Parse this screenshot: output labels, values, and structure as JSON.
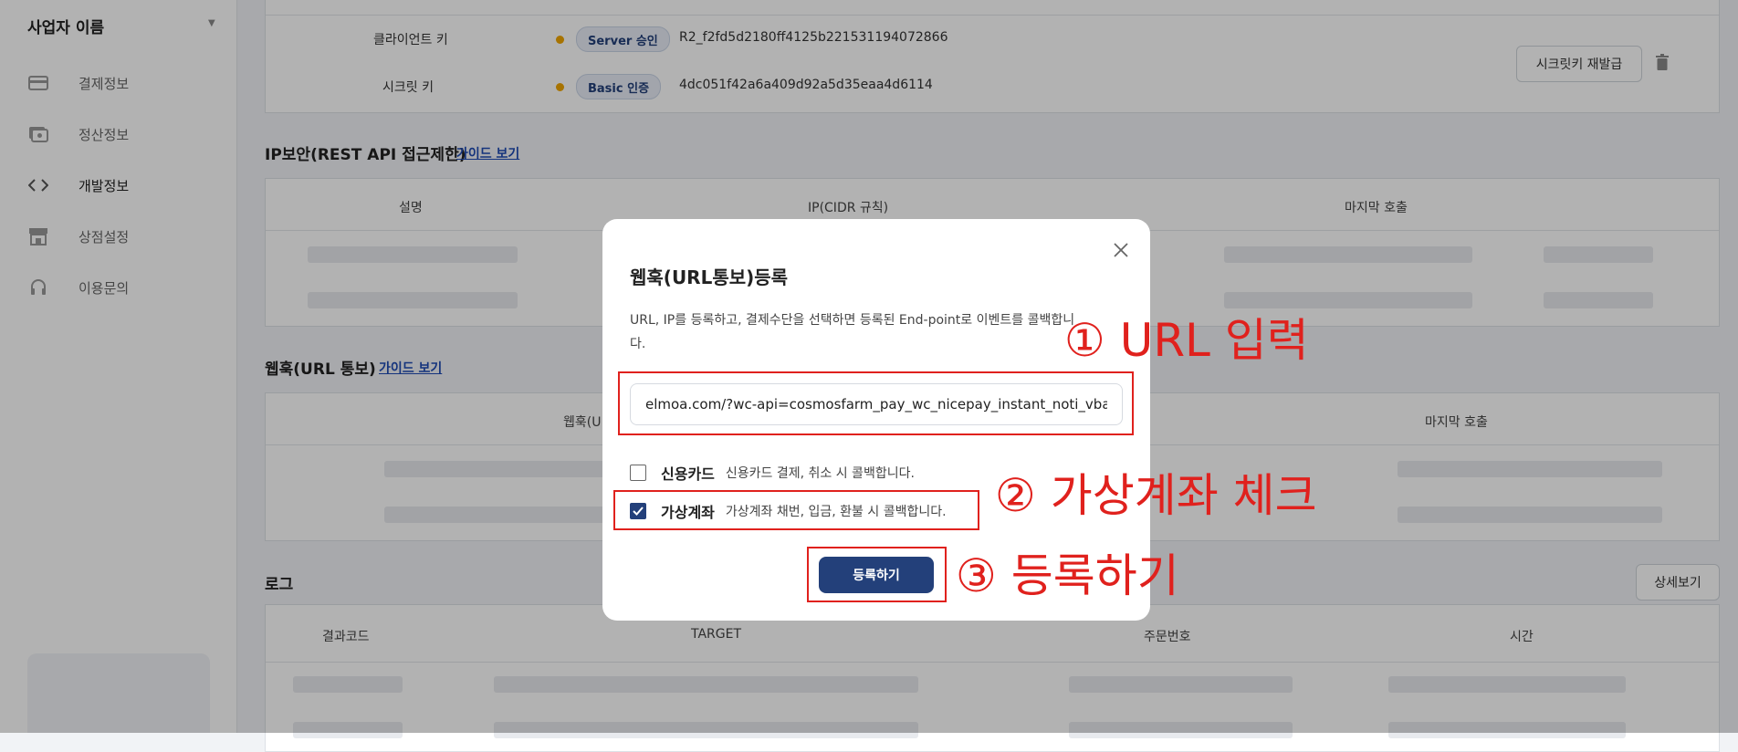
{
  "sidebar": {
    "business_name": "사업자 이름",
    "items": [
      {
        "label": "결제정보",
        "icon": "credit-card-icon"
      },
      {
        "label": "정산정보",
        "icon": "cash-icon"
      },
      {
        "label": "개발정보",
        "icon": "code-icon"
      },
      {
        "label": "상점설정",
        "icon": "store-icon"
      },
      {
        "label": "이용문의",
        "icon": "headset-icon"
      }
    ]
  },
  "keys": {
    "client_label": "클라이언트 키",
    "client_badge": "Server 승인",
    "client_value": "R2_f2fd5d2180ff4125b221531194072866",
    "secret_label": "시크릿 키",
    "secret_badge": "Basic 인증",
    "secret_value": "4dc051f42a6a409d92a5d35eaa4d6114",
    "reissue_button": "시크릿키 재발급"
  },
  "ip_section": {
    "title": "IP보안(REST API 접근제한)",
    "guide": "가이드 보기",
    "columns": [
      "설명",
      "IP(CIDR 규칙)",
      "마지막 호출"
    ]
  },
  "webhook_section": {
    "title": "웹훅(URL 통보)",
    "guide": "가이드 보기",
    "columns": [
      "웹훅(U",
      "마지막 호출"
    ]
  },
  "log_section": {
    "title": "로그",
    "detail_button": "상세보기",
    "columns": [
      "결과코드",
      "TARGET",
      "주문번호",
      "시간"
    ]
  },
  "modal": {
    "title": "웹훅(URL통보)등록",
    "description": "URL, IP를 등록하고, 결제수단을 선택하면 등록된 End-point로 이벤트를 콜백합니다.",
    "url_value": "elmoa.com/?wc-api=cosmosfarm_pay_wc_nicepay_instant_noti_vbank",
    "options": [
      {
        "title": "신용카드",
        "desc": "신용카드 결제, 취소 시 콜백합니다.",
        "checked": false
      },
      {
        "title": "가상계좌",
        "desc": "가상계좌 채번, 입금, 환불 시 콜백합니다.",
        "checked": true
      }
    ],
    "submit": "등록하기"
  },
  "annotations": {
    "step1": "① URL 입력",
    "step2": "② 가상계좌 체크",
    "step3": "③ 등록하기"
  },
  "colors": {
    "primary": "#23407a",
    "annotation_red": "#e0211d",
    "badge_dot": "#f0a500"
  }
}
